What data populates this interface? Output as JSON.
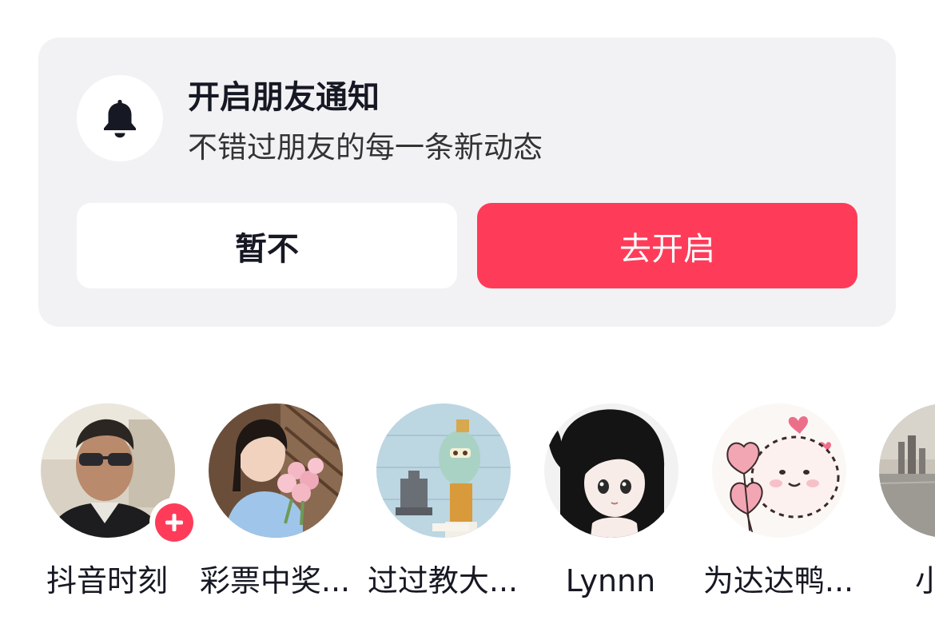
{
  "notification": {
    "title": "开启朋友通知",
    "subtitle": "不错过朋友的每一条新动态",
    "later_label": "暂不",
    "enable_label": "去开启",
    "icon": "bell-icon"
  },
  "friends": [
    {
      "name": "抖音时刻",
      "avatar": "avatar-man-sunglasses",
      "has_add_badge": true
    },
    {
      "name": "彩票中奖...",
      "avatar": "avatar-girl-flowers"
    },
    {
      "name": "过过教大...",
      "avatar": "avatar-cartoon-squid"
    },
    {
      "name": "Lynnn",
      "avatar": "avatar-anime-girl"
    },
    {
      "name": "为达达鸭...",
      "avatar": "avatar-cartoon-hearts"
    },
    {
      "name": "小新",
      "avatar": "avatar-city-view"
    }
  ],
  "colors": {
    "accent": "#fe3c59",
    "card_bg": "#f2f2f4",
    "text_primary": "#161823"
  }
}
